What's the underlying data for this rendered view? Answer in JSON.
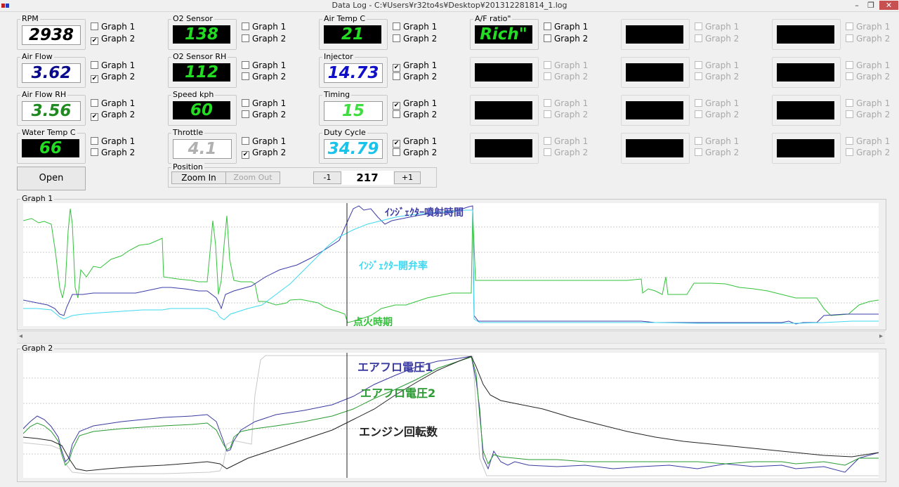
{
  "window": {
    "title": "Data Log - C:¥Users¥r32to4s¥Desktop¥201312281814_1.log"
  },
  "checkbox_labels": {
    "graph1": "Graph 1",
    "graph2": "Graph 2"
  },
  "gauges": {
    "rpm": {
      "label": "RPM",
      "value": "2938",
      "color": "#000000",
      "graph1": false,
      "graph2": true
    },
    "air_flow": {
      "label": "Air Flow",
      "value": "3.62",
      "color": "#0a0a8c",
      "graph1": false,
      "graph2": true
    },
    "air_flow_rh": {
      "label": "Air Flow RH",
      "value": "3.56",
      "color": "#1f8a1f",
      "graph1": false,
      "graph2": true
    },
    "water_temp": {
      "label": "Water Temp C",
      "value": "66",
      "color": "#22dd22",
      "graph1": false,
      "graph2": false
    },
    "o2_sensor": {
      "label": "O2 Sensor",
      "value": "138",
      "color": "#22dd22",
      "graph1": false,
      "graph2": false
    },
    "o2_sensor_rh": {
      "label": "O2 Sensor RH",
      "value": "112",
      "color": "#22dd22",
      "graph1": false,
      "graph2": false
    },
    "speed": {
      "label": "Speed kph",
      "value": "60",
      "color": "#22dd22",
      "graph1": false,
      "graph2": false
    },
    "throttle": {
      "label": "Throttle",
      "value": "4.1",
      "color": "#b0b0b0",
      "graph1": false,
      "graph2": true
    },
    "air_temp": {
      "label": "Air Temp C",
      "value": "21",
      "color": "#22dd22",
      "graph1": false,
      "graph2": false
    },
    "injector": {
      "label": "Injector",
      "value": "14.73",
      "color": "#1010c8",
      "graph1": true,
      "graph2": false
    },
    "timing": {
      "label": "Timing",
      "value": "15",
      "color": "#3fdd3f",
      "graph1": true,
      "graph2": false
    },
    "duty_cycle": {
      "label": "Duty Cycle",
      "value": "34.79",
      "color": "#19c3ea",
      "graph1": true,
      "graph2": false
    },
    "af_ratio": {
      "label": "A/F ratio\"",
      "value": "Rich\"",
      "color": "#22dd22",
      "graph1": false,
      "graph2": false
    }
  },
  "toolbar": {
    "open_label": "Open",
    "position_label": "Position",
    "zoom_in_label": "Zoom In",
    "zoom_out_label": "Zoom Out",
    "minus_label": "-1",
    "plus_label": "+1",
    "position_value": "217"
  },
  "graph1": {
    "label": "Graph 1",
    "annotations": {
      "injector": "ｲﾝｼﾞｪｸﾀｰ噴射時間",
      "duty": "ｲﾝｼﾞｪｸﾀｰ開弁率",
      "timing": "点火時期"
    }
  },
  "graph2": {
    "label": "Graph 2",
    "annotations": {
      "af1": "エアフロ電圧1",
      "af2": "エアフロ電圧2",
      "rpm": "エンジン回転数"
    }
  },
  "colors": {
    "injector": "#3c3ca8",
    "duty": "#3fd8f0",
    "timing": "#33c23a",
    "af1": "#3a3aa0",
    "af2": "#2a9a32",
    "rpm": "#222222",
    "throttle": "#c8c8c8"
  }
}
